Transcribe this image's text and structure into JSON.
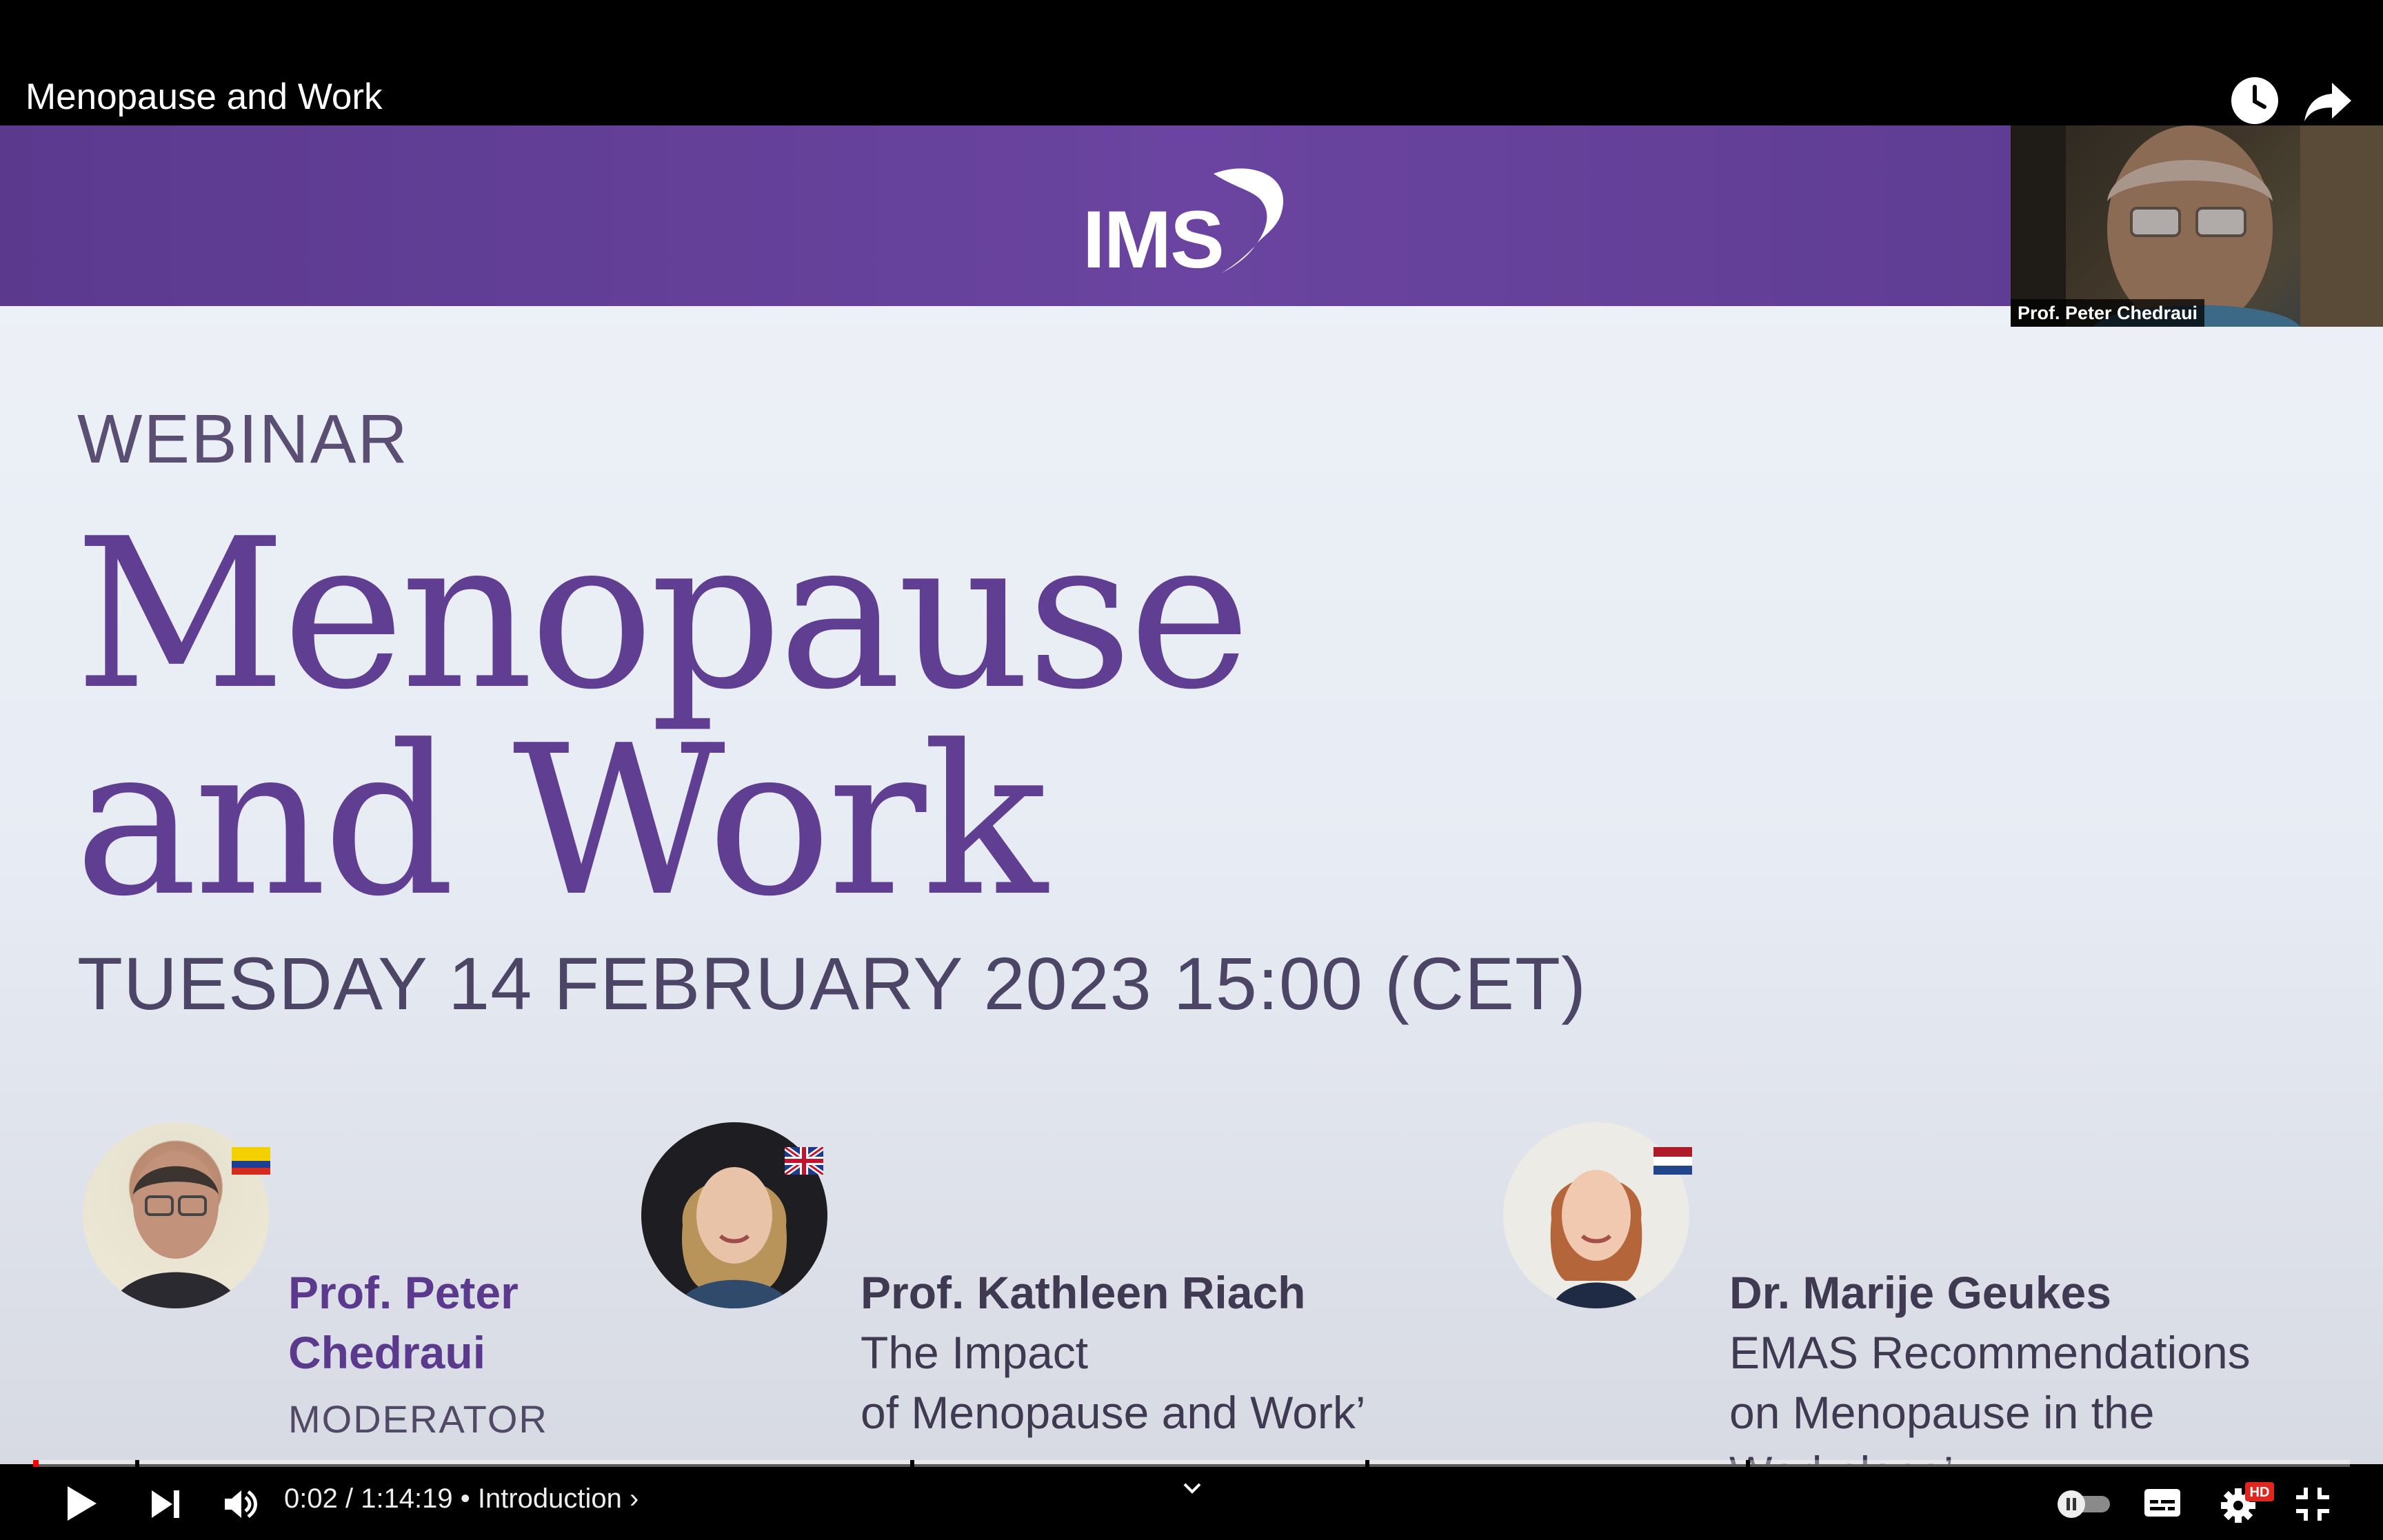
{
  "player": {
    "video_title": "Menopause and Work",
    "progress_fraction": 0.0005
  },
  "slide": {
    "webinar_label": "WEBINAR",
    "title_line1": "Menopause",
    "title_line2": "and Work",
    "date_line": "TUESDAY 14 FEBRUARY 2023 15:00 (CET)",
    "logo_text": "IMS",
    "speakers": [
      {
        "name_line1": "Prof. Peter",
        "name_line2": "Chedraui",
        "role": "MODERATOR",
        "flag": "ecuador-flag"
      },
      {
        "name": "Prof. Kathleen Riach",
        "talk_line1": "The Impact",
        "talk_line2": "of Menopause and Work’",
        "flag": "uk-flag"
      },
      {
        "name": "Dr. Marije Geukes",
        "talk_line1": "EMAS Recommendations",
        "talk_line2": "on Menopause in the",
        "talk_line3": "Workplace’",
        "flag": "netherlands-flag"
      }
    ]
  },
  "participant": {
    "label": "Prof. Peter Chedraui"
  },
  "controls": {
    "time_display": "0:02 / 1:14:19 • Introduction ›",
    "hd_badge": "HD",
    "icons": [
      "play-icon",
      "next-icon",
      "volume-icon",
      "chevron-down-icon",
      "autoplay-toggle-icon",
      "subtitles-icon",
      "settings-icon",
      "exit-fullscreen-icon",
      "watch-later-icon",
      "share-icon"
    ]
  },
  "colors": {
    "brand_purple": "#603f93",
    "header_purple": "#5b3a8e",
    "progress_red": "#ff0000"
  }
}
